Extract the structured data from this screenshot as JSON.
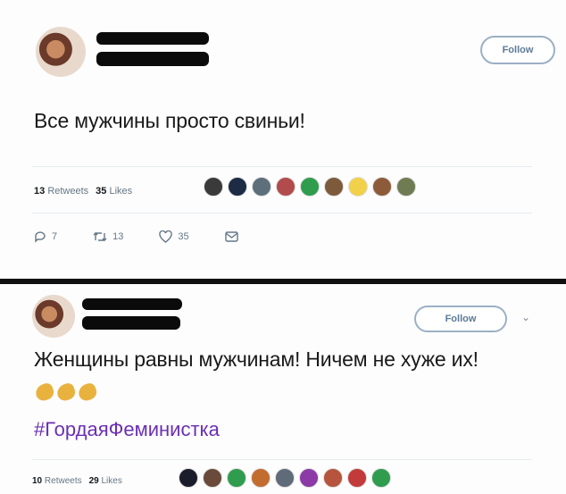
{
  "tweet1": {
    "text": "Все мужчины просто свиньи!",
    "follow_label": "Follow",
    "retweets_count": "13",
    "retweets_label": "Retweets",
    "likes_count": "35",
    "likes_label": "Likes",
    "actions": {
      "reply_count": "7",
      "retweet_count": "13",
      "like_count": "35"
    },
    "liker_colors": [
      "#3a3a3a",
      "#1d2b44",
      "#5c6f7a",
      "#b24b4b",
      "#2f9c4e",
      "#7e5a3c",
      "#f2d14a",
      "#8e5b3a",
      "#6f7b52"
    ]
  },
  "tweet2": {
    "text": "Женщины равны мужчинам! Ничем не хуже их!",
    "hashtag": "#ГордаяФеминистка",
    "follow_label": "Follow",
    "retweets_count": "10",
    "retweets_label": "Retweets",
    "likes_count": "29",
    "likes_label": "Likes",
    "emoji_count": 3,
    "liker_colors": [
      "#1b1d2a",
      "#6a4a3a",
      "#2f9c4e",
      "#c26c2f",
      "#5f6b78",
      "#8b3aa6",
      "#b6543e",
      "#c23a3a",
      "#2f9c4e"
    ]
  },
  "colors": {
    "accent_purple": "#6b2fb3",
    "follow_text": "#5c7a96",
    "muted": "#657786"
  }
}
